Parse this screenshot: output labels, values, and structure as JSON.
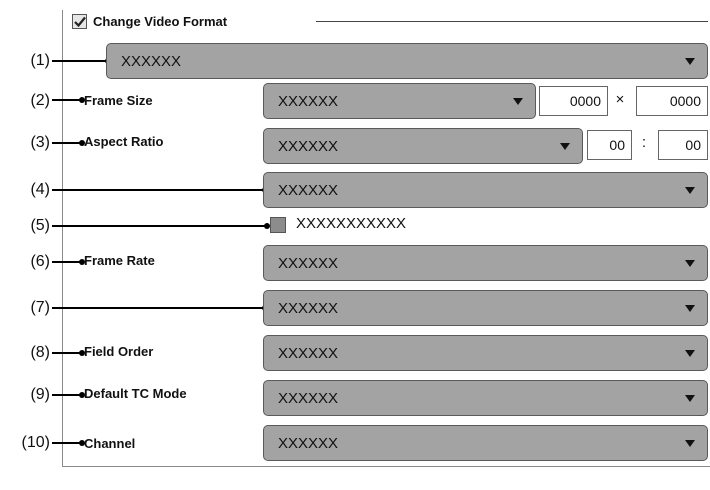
{
  "group": {
    "title": "Change Video Format",
    "checked": true
  },
  "callouts": [
    "(1)",
    "(2)",
    "(3)",
    "(4)",
    "(5)",
    "(6)",
    "(7)",
    "(8)",
    "(9)",
    "(10)"
  ],
  "rows": {
    "preset": {
      "value": "XXXXXX"
    },
    "frame_size": {
      "label": "Frame Size",
      "value": "XXXXXX",
      "width": "0000",
      "times": "×",
      "height": "0000"
    },
    "aspect_ratio": {
      "label": "Aspect Ratio",
      "value": "XXXXXX",
      "num": "00",
      "colon": ":",
      "den": "00"
    },
    "row4": {
      "value": "XXXXXX"
    },
    "row5": {
      "checkbox_label": "XXXXXXXXXXX"
    },
    "frame_rate": {
      "label": "Frame Rate",
      "value": "XXXXXX"
    },
    "row7": {
      "value": "XXXXXX"
    },
    "field_order": {
      "label": "Field Order",
      "value": "XXXXXX"
    },
    "default_tc_mode": {
      "label": "Default TC Mode",
      "value": "XXXXXX"
    },
    "channel": {
      "label": "Channel",
      "value": "XXXXXX"
    }
  },
  "colors": {
    "dropdown_fill": "#a3a3a3",
    "checkbox_fill": "#8c8c8c"
  }
}
